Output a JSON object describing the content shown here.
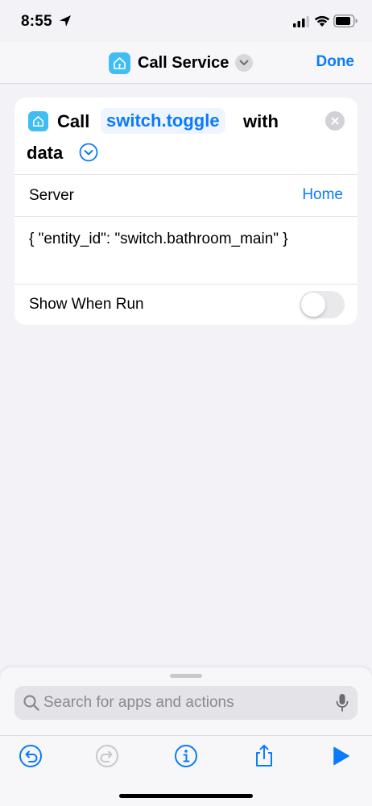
{
  "status_bar": {
    "time": "8:55",
    "icons": [
      "location-arrow-icon",
      "cellular-signal-icon",
      "wifi-icon",
      "battery-icon"
    ]
  },
  "nav": {
    "title": "Call Service",
    "done_label": "Done",
    "app_icon": "home-assistant-icon",
    "chevron_icon": "chevron-down-icon"
  },
  "action": {
    "call_label": "Call",
    "service": "switch.toggle",
    "with_label": "with",
    "data_label": "data",
    "expand_icon": "chevron-down-circle-icon",
    "remove_icon": "close-icon"
  },
  "rows": {
    "server_label": "Server",
    "server_value": "Home",
    "data_value": "{ \"entity_id\": \"switch.bathroom_main\" }",
    "show_when_run_label": "Show When Run",
    "show_when_run_on": false
  },
  "search": {
    "placeholder": "Search for apps and actions",
    "value": ""
  },
  "toolbar": {
    "icons": [
      "undo-icon",
      "redo-icon",
      "info-icon",
      "share-icon",
      "play-icon"
    ]
  },
  "colors": {
    "accent": "#0a7aff",
    "app_icon_bg": "#41bdf5",
    "background": "#f2f2f7",
    "disabled": "#c7c7cc"
  }
}
